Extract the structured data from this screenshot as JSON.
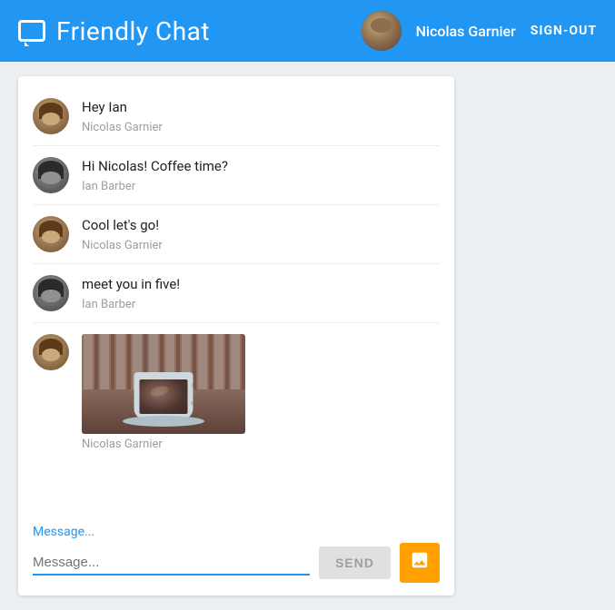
{
  "header": {
    "title": "Friendly Chat",
    "username": "Nicolas Garnier",
    "signout_label": "SIGN-OUT"
  },
  "messages": [
    {
      "id": 1,
      "text": "Hey Ian",
      "sender": "Nicolas Garnier",
      "avatar_type": "nicolas",
      "has_image": false
    },
    {
      "id": 2,
      "text": "Hi Nicolas! Coffee time?",
      "sender": "Ian Barber",
      "avatar_type": "ian",
      "has_image": false
    },
    {
      "id": 3,
      "text": "Cool let's go!",
      "sender": "Nicolas Garnier",
      "avatar_type": "nicolas",
      "has_image": false
    },
    {
      "id": 4,
      "text": "meet you in five!",
      "sender": "Ian Barber",
      "avatar_type": "ian",
      "has_image": false
    },
    {
      "id": 5,
      "text": "",
      "sender": "Nicolas Garnier",
      "avatar_type": "nicolas",
      "has_image": true
    }
  ],
  "input": {
    "placeholder": "Message...",
    "label": "Message...",
    "value": "",
    "send_label": "SEND"
  }
}
